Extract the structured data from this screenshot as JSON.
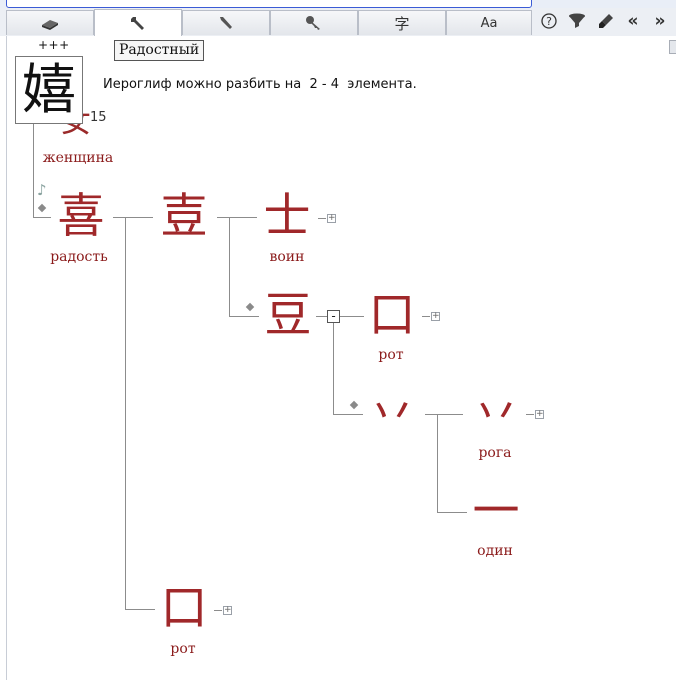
{
  "tabs": [
    {
      "name": "book",
      "icon": "book-icon"
    },
    {
      "name": "tools",
      "icon": "wrench-icon"
    },
    {
      "name": "brush",
      "icon": "brush-icon"
    },
    {
      "name": "key",
      "icon": "key-icon"
    },
    {
      "name": "character",
      "label": "字"
    },
    {
      "name": "font",
      "label": "Aa"
    }
  ],
  "toolbar_right": [
    "?",
    "funnel",
    "eraser",
    "«",
    "»"
  ],
  "glyph": {
    "plus_marks": "+++",
    "character": "嬉",
    "stroke_count": "15",
    "tooltip": "Радостный",
    "decomposition_text": "Иероглиф можно разбить на  2 - 4  элемента."
  },
  "tree": {
    "radical": {
      "char": "女",
      "label": "женщина"
    },
    "n_joy": {
      "char": "喜",
      "label": "радость"
    },
    "n_drum": {
      "char": "壴",
      "label": ""
    },
    "n_warrior": {
      "char": "士",
      "label": "воин"
    },
    "n_bean": {
      "char": "豆",
      "label": ""
    },
    "n_mouth1": {
      "char": "口",
      "label": "рот"
    },
    "n_top": {
      "char": "丷",
      "label": ""
    },
    "n_horns": {
      "char": "丷",
      "label": "рога"
    },
    "n_one": {
      "char": "一",
      "label": "один"
    },
    "n_mouth2": {
      "char": "口",
      "label": "рот"
    },
    "expander_minus": "-",
    "expander_plus": "+"
  },
  "colors": {
    "glyph": "#a0282a",
    "label": "#8b1b1b",
    "line": "#8c8c8c"
  }
}
